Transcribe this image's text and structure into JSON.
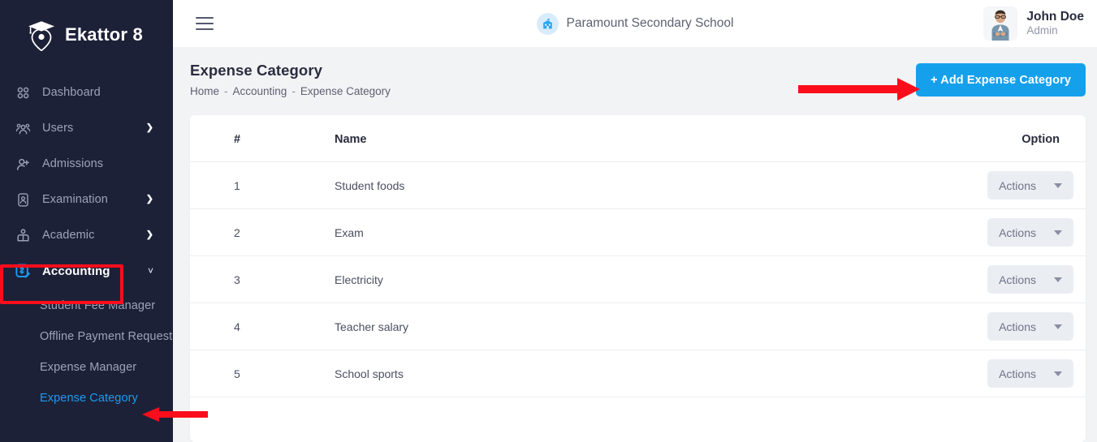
{
  "brand": {
    "name": "Ekattor 8",
    "logo_icon": "graduation-cap-pin-logo"
  },
  "sidebar": {
    "items": [
      {
        "label": "Dashboard",
        "icon": "grid-dots-icon",
        "has_caret": false,
        "active": false
      },
      {
        "label": "Users",
        "icon": "users-group-icon",
        "has_caret": true,
        "active": false
      },
      {
        "label": "Admissions",
        "icon": "user-plus-icon",
        "has_caret": false,
        "active": false
      },
      {
        "label": "Examination",
        "icon": "id-card-icon",
        "has_caret": true,
        "active": false
      },
      {
        "label": "Academic",
        "icon": "person-desk-icon",
        "has_caret": true,
        "active": false
      },
      {
        "label": "Accounting",
        "icon": "invoice-dollar-icon",
        "has_caret": true,
        "active": true
      }
    ],
    "subitems": [
      {
        "label": "Student Fee Manager",
        "active": false
      },
      {
        "label": "Offline Payment Request",
        "active": false
      },
      {
        "label": "Expense Manager",
        "active": false
      },
      {
        "label": "Expense Category",
        "active": true
      }
    ]
  },
  "topbar": {
    "menu_icon": "hamburger-icon",
    "school_name": "Paramount Secondary School",
    "school_icon": "school-building-icon",
    "profile": {
      "name": "John Doe",
      "role": "Admin",
      "avatar_icon": "user-photo-avatar"
    }
  },
  "page": {
    "title": "Expense Category",
    "breadcrumb": [
      "Home",
      "Accounting",
      "Expense Category"
    ],
    "breadcrumb_separator": "-",
    "add_button_label": "+ Add Expense Category"
  },
  "table": {
    "columns": [
      "#",
      "Name",
      "Option"
    ],
    "rows": [
      {
        "num": "1",
        "name": "Student foods",
        "action_label": "Actions"
      },
      {
        "num": "2",
        "name": "Exam",
        "action_label": "Actions"
      },
      {
        "num": "3",
        "name": "Electricity",
        "action_label": "Actions"
      },
      {
        "num": "4",
        "name": "Teacher salary",
        "action_label": "Actions"
      },
      {
        "num": "5",
        "name": "School sports",
        "action_label": "Actions"
      }
    ]
  },
  "annotations": {
    "highlight_box_target": "Accounting",
    "arrow_to_add_button": "+ Add Expense Category",
    "arrow_to_expense_category": "Expense Category",
    "color": "#fc0d1b"
  },
  "colors": {
    "sidebar_bg": "#1d2138",
    "accent_blue": "#15a0ec",
    "page_bg": "#f2f3f5",
    "annotation_red": "#fc0d1b"
  }
}
